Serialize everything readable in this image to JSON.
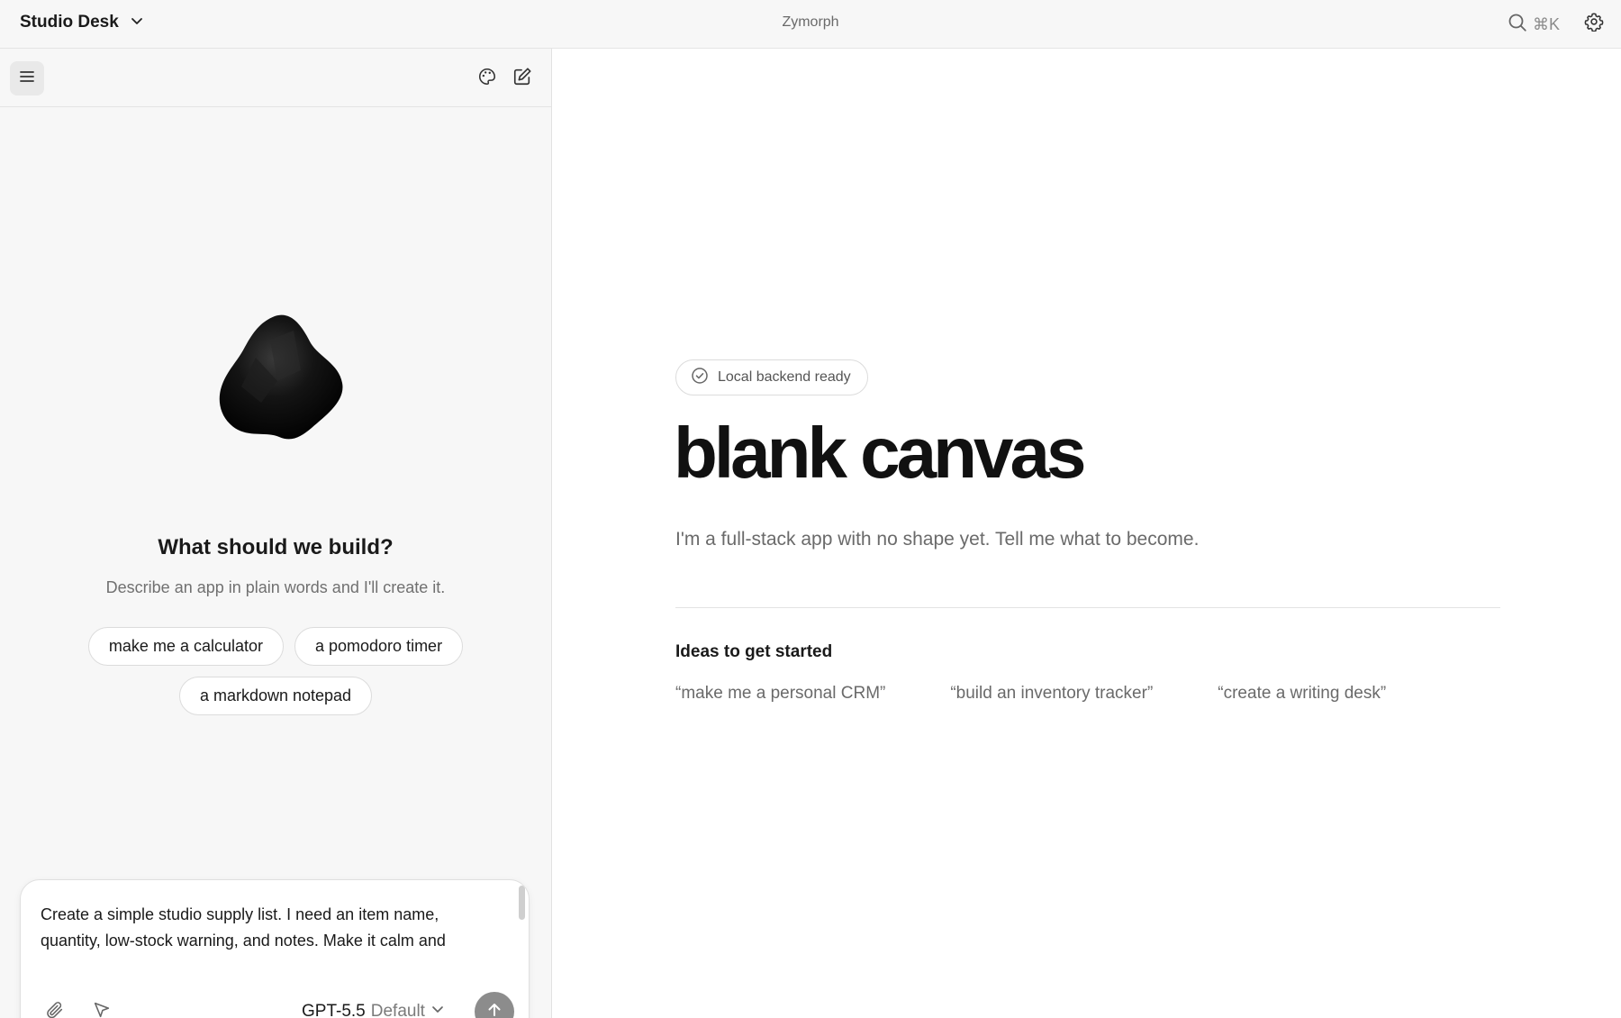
{
  "topbar": {
    "workspace_name": "Studio Desk",
    "app_title": "Zymorph",
    "search_shortcut": "⌘K"
  },
  "icons": {
    "workspace_menu": "chevron-down-icon",
    "search": "search-icon",
    "settings": "gear-icon",
    "sidebar_menu": "hamburger-menu-icon",
    "theme": "palette-icon",
    "new_chat": "edit-icon",
    "attach": "paperclip-icon",
    "select": "cursor-icon",
    "send": "arrow-up-icon",
    "status": "check-circle-icon"
  },
  "left_panel": {
    "prompt_title": "What should we build?",
    "prompt_subtitle": "Describe an app in plain words and I'll create it.",
    "suggestions": [
      "make me a calculator",
      "a pomodoro timer",
      "a markdown notepad"
    ]
  },
  "composer": {
    "input_value": "Create a simple studio supply list. I need an item name, quantity, low-stock warning, and notes. Make it calm and",
    "model_name": "GPT-5.5",
    "model_mode": "Default"
  },
  "canvas": {
    "status": "Local backend ready",
    "title": "blank canvas",
    "subtitle": "I'm a full-stack app with no shape yet. Tell me what to become.",
    "ideas_heading": "Ideas to get started",
    "ideas": [
      "“make me a personal CRM”",
      "“build an inventory tracker”",
      "“create a writing desk”"
    ]
  },
  "colors": {
    "panel_bg": "#f7f7f7",
    "canvas_bg": "#ffffff",
    "send_button": "#8c8c8c",
    "muted_text": "#6a6a6a"
  }
}
